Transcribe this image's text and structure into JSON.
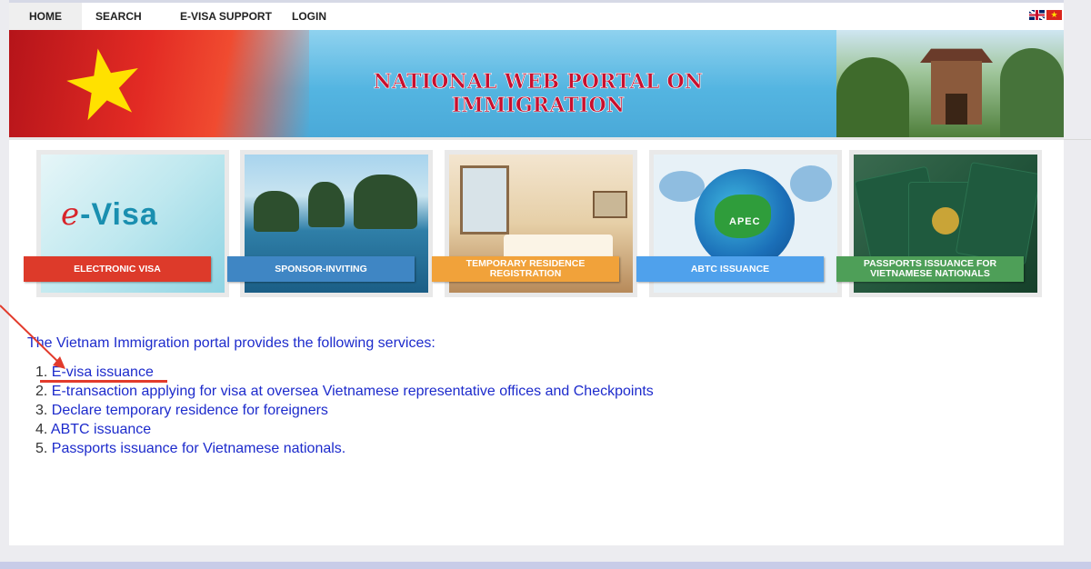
{
  "nav": {
    "home": "HOME",
    "search": "SEARCH",
    "support": "E-VISA SUPPORT",
    "login": "LOGIN"
  },
  "flags": [
    "uk-flag",
    "vietnam-flag"
  ],
  "banner": {
    "title": "NATIONAL WEB PORTAL ON IMMIGRATION"
  },
  "cards": [
    {
      "label": "ELECTRONIC VISA",
      "image_text": "-Visa",
      "image_letter": "e",
      "color": "#dd3a2a"
    },
    {
      "label": "SPONSOR-INVITING",
      "color": "#3f86c4"
    },
    {
      "label": "TEMPORARY RESIDENCE REGISTRATION",
      "color": "#f1a23a"
    },
    {
      "label": "ABTC ISSUANCE",
      "image_text": "APEC",
      "color": "#4fa1ec"
    },
    {
      "label": "PASSPORTS ISSUANCE FOR VIETNAMESE NATIONALS",
      "color": "#4e9f58"
    }
  ],
  "content": {
    "intro": "The Vietnam Immigration portal provides the following services:",
    "services": [
      {
        "num": "1.",
        "text": "E-visa issuance"
      },
      {
        "num": "2.",
        "text": "E-transaction applying for visa at oversea Vietnamese representative offices and Checkpoints"
      },
      {
        "num": "3.",
        "text": "Declare temporary residence for foreigners"
      },
      {
        "num": "4.",
        "text": "ABTC issuance"
      },
      {
        "num": "5.",
        "text": "Passports issuance for Vietnamese nationals."
      }
    ]
  },
  "colors": {
    "link": "#1d2bcc",
    "annotation": "#e23b2c"
  }
}
